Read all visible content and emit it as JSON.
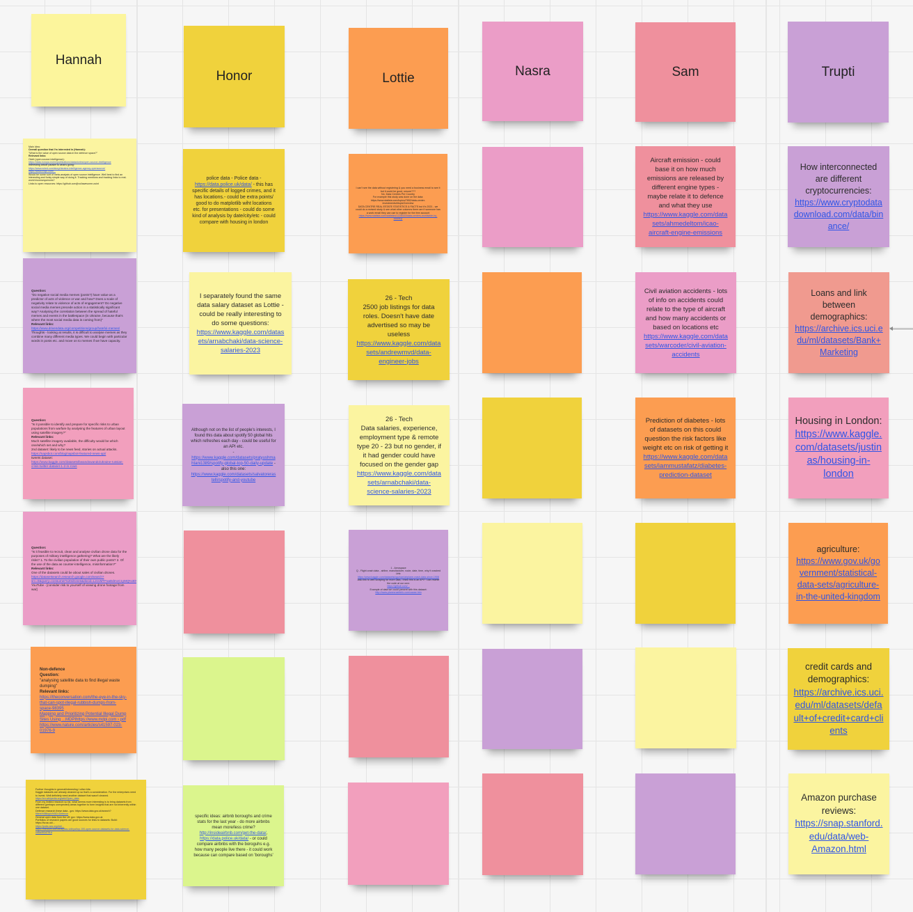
{
  "board": {
    "columns": [
      {
        "name": "Hannah",
        "notes": [
          {
            "lines": [
              "Main Idea:",
              "Overall question that I'm interested in (Hannah):",
              "\"What is the value of open source data in the defence space?\"",
              "Relevant links:",
              "Osint (open-source intelligence):",
              "https://data.europa.eu/en/publications/datastories/open-source-intelligence",
              "Interesting article parallel to what's going:",
              "https://www.wired.com/story/ukraine-intelligence-agency-opensource/",
              "https://www.mdpi.com/...",
              "Would be some sort of meta-analysis of open source intelligence. Well best to find an interesting and funky simple way of doing it. Tracking mentions and tracking links to real-world inconsequences?",
              "Links to open resources: https://github.com/jivoi/awesome-osint"
            ]
          },
          {
            "question_label": "Question:",
            "question": "\"Do negative social media memes (posts?) have value as a predictor of acts of violence or war and how? Does a scale of negativity relate to violence of acts of engagement? Do negative social media memes precede action in a statistically significant way? Analysing the correlation between the spread of hateful memes and events in the battlespace (in Ukraine, because that's where the most social media data is coming from)\"",
            "links_label": "Relevant links:",
            "link": "https://www.drivendata.org/competitions/group/hateful-memes/",
            "extra": "Thoughts - looking at results, it is difficult to analyse memes as they combine many different media types. We could begin with particular words in posts etc. and move on to memes if we have capacity."
          },
          {
            "question_label": "Question:",
            "question": "\"Is it possible to identify and prepare for specific risks to urban populations from warfare by analysing the features of urban layout using satellite imagery?\"",
            "links_label": "Relevant links:",
            "body": "Much satellite imagery available, the difficulty would be which one/which set and why?\n2nd dataset: likely to be news feed, stories on actual attacks.",
            "link": "https://napsbot.com/blog/napsbot-featured-news-api/",
            "body2": "tweets dataset:",
            "link2": "https://www.kaggle.com/datasets/bwandowando/ukraine-russian-crisis-twitter-dataset-1-2-m-rows"
          },
          {
            "question_label": "Question:",
            "question": "\"Is it feasible to recruit, clean and analyse civilian drone data for the purposes of military intelligence gathering? What are the likely risks? 1. To the civilian population of their own public posts? 2. Of the use of the data as counter-intelligence, misinformation?\"",
            "links_label": "Relevant links:",
            "body": "One of the datasets could be about sales of civilian drones.",
            "link": "https://datasetsearch.research.google.com/search?src=0&query=consumer%20drones&docid=L2cvMTFoaDdmcC1yMQ%3D%3D",
            "body2": "YouTube - [consider risk to yourself of viewing drone footage from war]"
          },
          {
            "title": "Non-defence",
            "question_label": "Question:",
            "question": "\"analysing satellite data to find illegal waste dumping\"",
            "links_label": "Relevant links:",
            "link": "https://theconversation.com/the-eye-in-the-sky-that-can-spot-illegal-rubbish-dumps-from-space-98395",
            "link2": "Mapping and Prioritizing Potential Illegal Dump Sites Using ...MDPIhttps://www.mdpi.com › pdf",
            "link3": "https://www.nature.com/articles/s41597-023-01976-9"
          },
          {
            "lines": [
              "Further thoughts in general/interesting t other bits:",
              "Kaggle datasets are already cleaned up so that's a consideration. For the enterprises need to invest. Well definitely need another dataset that wasn't cleaned.",
              "https://en.wikipedia.org/wiki/Open_data",
              "From my limited research so far, what seems more interesting is to bring datasets from different (perhaps unexpected) areas together to form insights that are not inherently within one dataset.",
              "Defence research these data - gov: https://www.data.gov.uk/search?",
              "filters%5Btopic%5D=Defence",
              "General open data from the UK gov: https://www.data.gov.uk",
              "Portfolios of research papers are good sources for links to datasets: Build: https://hv.ac.uk/...",
              "https://pubs.acs.org/doi/...",
              "https://medium.com/analytics-vidhya/top-100-open-source-datasets-for-data-science-cd5a492d791d"
            ]
          }
        ]
      },
      {
        "name": "Honor",
        "notes": [
          {
            "text": "police data - Police data - ",
            "link": "https://data.police.uk/data/",
            "text2": " - this has specific details of logged crimes, and it has locations.- could be extra points/ good to do matplotlib wiht locations etc. for presentations - could do some kind of analysis by date/city/etc - could compare with housing in london"
          },
          {
            "text": "I separately found the same data salary dataset as Lottie - could be really interesting to do some questions: ",
            "link": "https://www.kaggle.com/datasets/arnabchaki/data-science-salaries-2023"
          },
          {
            "text": "Although not on the list of people's interests, I found this data about spotify 50 global hits which refreshes each day - could be useful for an API etc.\n- ",
            "link": "https://www.kaggle.com/datasets/pratyushmahtani1389/spotify-global-top-50-daily-update",
            "text2": " - also this one: ",
            "link2": "https://www.kaggle.com/datasets/salvatorerastelli/spotify-and-youtube"
          },
          {
            "text": ""
          },
          {
            "text": ""
          },
          {
            "text": "specific ideas: airbnb boroughs and crime stats for the last year - do more airbnbs mean more/less crime? ",
            "link": "http://insideairbnb.com/get-the-data/",
            "text2": ", ",
            "link2": "https://data.police.uk/data/",
            "text3": " - or could compare airbnbs with the boroguhs e.g. how many people live there - it could work because can compare based on 'boroughs'"
          }
        ]
      },
      {
        "name": "Lottie",
        "notes": [
          {
            "lines": [
              "I can't see the data without registering & you need a business email to see it but it could be good, unsure???",
              "No. Data Centres Per Country",
              "For example this study was done on the data: https://www.statista.com/topics/7652/data-center-investments/#topicOverview",
              "DATA CENTRE REAL ESTATE STATISTICS & FACTS but it's 2021 - we could do a revised study & see what other columns there are if someone has a work email they can use to register for the free account",
              "https://www.statista.com/statistics/1228433/data-centers-worldwide-by-country/"
            ]
          },
          {
            "text": "26 - Tech\n2500 job listings for data roles. Doesn't have date advertised so may be useless\n",
            "link": "https://www.kaggle.com/datasets/andrewmvd/data-engineer-jobs"
          },
          {
            "text": "26 - Tech\nData salaries, experience, employment type & remote type 20 - 23 but no gender, if it had gender could have focused on the gender gap\n",
            "link": "https://www.kaggle.com/datasets/arnabchaki/data-science-salaries-2023"
          },
          {
            "lines": [
              "1 - Aerospace",
              "Q - Flight crash data - airline, manufacturer, route, date, time, why it crashed",
              "Link:",
              "https://www.kaggle.com/datasets/cgurkan/airplane-crash-data-since-1908",
              "Also link to web scraping for more data, I think this is an API? I can rewrite the code at our own:",
              "https://github.com/...",
              "Example of data we could present with this dataset:",
              "http://www.planecrashinfo.com/cause.htm"
            ]
          },
          {
            "text": ""
          },
          {
            "text": ""
          }
        ]
      },
      {
        "name": "Nasra",
        "notes": [
          {
            "text": ""
          },
          {
            "text": ""
          },
          {
            "text": ""
          },
          {
            "text": ""
          },
          {
            "text": ""
          },
          {
            "text": ""
          }
        ]
      },
      {
        "name": "Sam",
        "notes": [
          {
            "text": "Aircraft emission - could base it on how much emissions are released by different engine types - maybe relate it to defence and what they use\n",
            "link": "https://www.kaggle.com/datasets/ahmedeltom/icao-aircraft-engine-emissions"
          },
          {
            "text": "Civil aviation accidents - lots of info on accidents could relate to the type of aircraft and how many accidents or based on locations etc\n",
            "link": "https://www.kaggle.com/datasets/warcoder/civil-aviation-accidents"
          },
          {
            "text": "Prediction of diabetes - lots of datasets on this could question the risk factors like weight etc on risk of getting it\n",
            "link": "https://www.kaggle.com/datasets/iammustafatz/diabetes-prediction-dataset"
          },
          {
            "text": ""
          },
          {
            "text": ""
          },
          {
            "text": ""
          }
        ]
      },
      {
        "name": "Trupti",
        "notes": [
          {
            "text": "How interconnected are different cryptocurrencies:\n",
            "link": "https://www.cryptodatadownload.com/data/binance/"
          },
          {
            "text": "Loans and link between demographics:\n",
            "link": "https://archive.ics.uci.edu/ml/datasets/Bank+Marketing"
          },
          {
            "text": "Housing in London:\n",
            "link": "https://www.kaggle.com/datasets/justinas/housing-in-london"
          },
          {
            "text": "agriculture: ",
            "link": "https://www.gov.uk/government/statistical-data-sets/agriculture-in-the-united-kingdom"
          },
          {
            "text": "credit cards and demographics:\n",
            "link": "https://archive.ics.uci.edu/ml/datasets/default+of+credit+card+clients"
          },
          {
            "text": "Amazon purchase reviews:\n",
            "link": "https://snap.stanford.edu/data/web-Amazon.html"
          }
        ]
      }
    ]
  },
  "colors": {
    "yellow": "#fcf59c",
    "gold": "#f0d23c",
    "orange": "#fc9d51",
    "pink": "#eb9dc7",
    "salmon": "#ef909d",
    "purple": "#c9a0d6",
    "green": "#dbf58d",
    "link": "#2f55e6"
  }
}
